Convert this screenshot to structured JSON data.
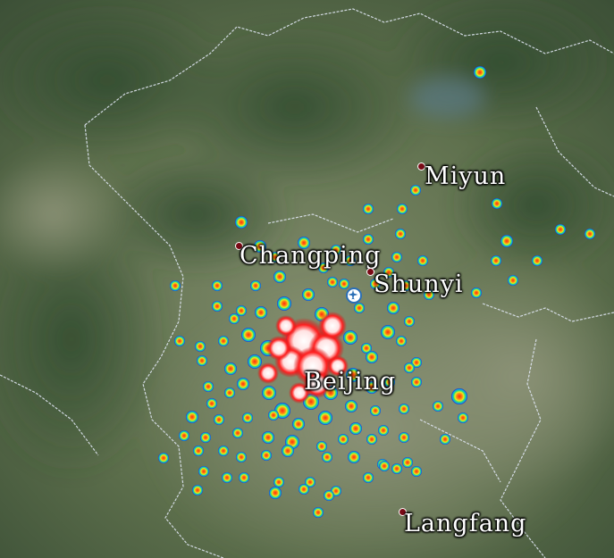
{
  "map": {
    "background": "satellite-terrain",
    "boundary_color": "#dfe6f2",
    "heat_colors": [
      "#1030c8",
      "#12a6e0",
      "#2fe07a",
      "#e6f020",
      "#ff7a10",
      "#e01010",
      "#ffffff"
    ]
  },
  "cities": [
    {
      "key": "miyun",
      "label": "Miyun"
    },
    {
      "key": "changping",
      "label": "Changping"
    },
    {
      "key": "shunyi",
      "label": "Shunyi"
    },
    {
      "key": "beijing",
      "label": "Beijing"
    },
    {
      "key": "langfang",
      "label": "Langfang"
    }
  ],
  "airport": {
    "icon": "airplane-icon"
  }
}
